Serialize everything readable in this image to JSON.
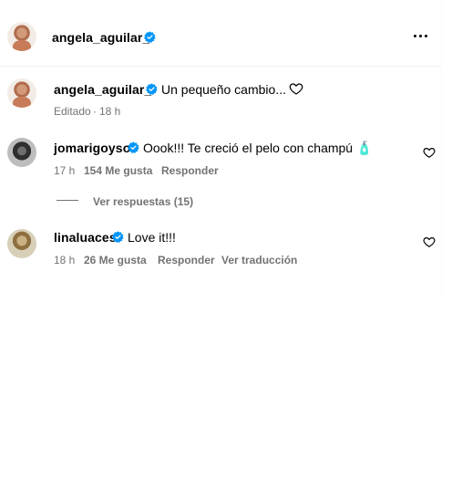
{
  "post": {
    "header": {
      "username": "angela_aguilar_"
    },
    "caption": {
      "username": "angela_aguilar_",
      "text": "Un pequeño cambio...",
      "edited_label": "Editado",
      "separator": "·",
      "time": "18 h"
    }
  },
  "comments": [
    {
      "username": "jomarigoyso",
      "text": "Oook!!! Te creció el pelo con champú 🧴",
      "time": "17 h",
      "likes": "154 Me gusta",
      "reply_label": "Responder",
      "view_replies": "Ver respuestas (15)"
    },
    {
      "username": "linaluaces",
      "text": "Love it!!!",
      "time": "18 h",
      "likes": "26 Me gusta",
      "reply_label": "Responder",
      "translate_label": "Ver traducción"
    }
  ],
  "icons": {
    "verified": "verified-badge-icon",
    "more": "more-options-icon",
    "heart": "heart-outline-icon"
  },
  "colors": {
    "verified_blue": "#0095f6",
    "secondary_text": "#737373",
    "divider": "#efefef"
  }
}
